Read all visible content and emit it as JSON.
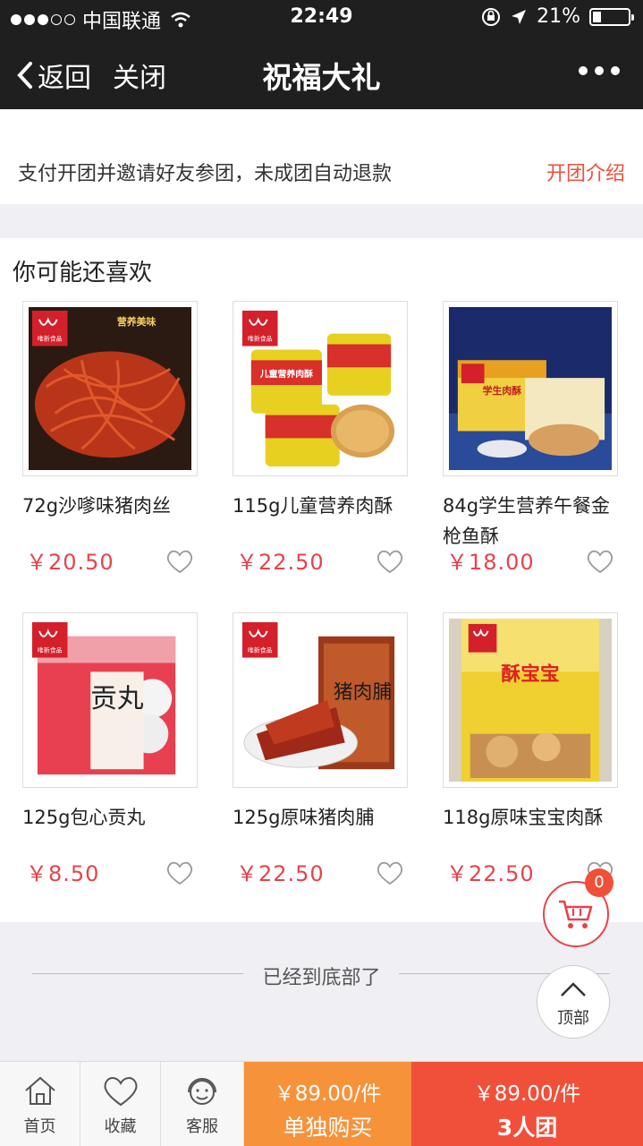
{
  "status_bar": {
    "carrier": "中国联通",
    "time": "22:49",
    "battery": "21%"
  },
  "nav": {
    "back_label": "返回",
    "close_label": "关闭",
    "title": "祝福大礼"
  },
  "notice": {
    "text": "支付开团并邀请好友参团，未成团自动退款",
    "link": "开团介绍"
  },
  "recommend": {
    "heading": "你可能还喜欢",
    "items": [
      {
        "name": "72g沙嗲味猪肉丝",
        "price": "￥20.50",
        "brand": "唯新食品",
        "tag": "营养美味"
      },
      {
        "name": "115g儿童营养肉酥",
        "price": "￥22.50",
        "brand": "唯新食品",
        "tag": "儿童营养肉酥"
      },
      {
        "name": "84g学生营养午餐金枪鱼酥",
        "price": "￥18.00",
        "brand": "唯新食品",
        "tag": "学生肉酥"
      },
      {
        "name": "125g包心贡丸",
        "price": "￥8.50",
        "brand": "唯新食品",
        "tag": "贡丸"
      },
      {
        "name": "125g原味猪肉脯",
        "price": "￥22.50",
        "brand": "唯新食品",
        "tag": "猪肉脯"
      },
      {
        "name": "118g原味宝宝肉酥",
        "price": "￥22.50",
        "brand": "唯新食品",
        "tag": "酥宝宝"
      }
    ]
  },
  "end_text": "已经到底部了",
  "cart": {
    "count": "0"
  },
  "to_top": "顶部",
  "tabbar": {
    "home": "首页",
    "favorite": "收藏",
    "service": "客服",
    "single": {
      "price": "￥89.00/件",
      "label": "单独购买"
    },
    "group": {
      "price": "￥89.00/件",
      "label": "3人团"
    }
  },
  "colors": {
    "accent": "#f0503a",
    "price": "#e8434a",
    "single_bg": "#f6923a",
    "group_bg": "#f0503a",
    "nav_bg": "#1f1f20"
  }
}
